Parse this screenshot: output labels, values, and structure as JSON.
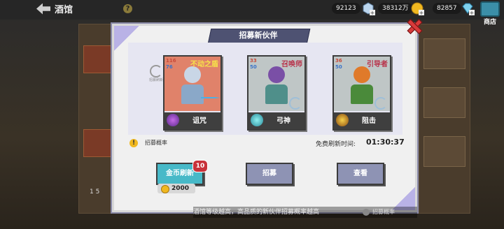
{
  "topbar": {
    "back_label": "酒馆",
    "help_label": "?",
    "resources": [
      {
        "icon": "gem-plus-icon",
        "value": "92123"
      },
      {
        "icon": "gold-coin-icon",
        "value": "38312万"
      },
      {
        "icon": "diamond-icon",
        "value": "82857"
      }
    ],
    "shop_label": "商店"
  },
  "modal": {
    "title": "招募新伙伴",
    "refresh_small_label": "招募刷新",
    "cards": [
      {
        "atk": "116",
        "def": "76",
        "role": "不动之盾",
        "skill": "诅咒",
        "skill_icon": "purple-flame-icon",
        "colors": {
          "bg": "#e0826a",
          "head": "#c9d6e6",
          "body": "#8aa8c8"
        }
      },
      {
        "atk": "33",
        "def": "50",
        "role": "召唤师",
        "skill": "弓神",
        "skill_icon": "cyan-crystal-icon",
        "colors": {
          "bg": "#bfc6c6",
          "head": "#7a4fa6",
          "body": "#4f8f8a"
        }
      },
      {
        "atk": "36",
        "def": "50",
        "role": "引导者",
        "skill": "阻击",
        "skill_icon": "fire-blast-icon",
        "colors": {
          "bg": "#bfc6c6",
          "head": "#e07a2a",
          "body": "#4a8a3a"
        }
      }
    ],
    "info_label": "招募概率",
    "free_refresh_label": "免费刷新时间:",
    "free_refresh_time": "01:30:37",
    "buttons": {
      "gold_refresh": "金币刷新",
      "gold_refresh_badge": "10",
      "gold_refresh_cost": "2000",
      "recruit": "招募",
      "view": "查看"
    }
  },
  "bottom_note": "酒馆等级越高，高品质的新伙伴招募概率越高",
  "bottom_right_label": "招募概率",
  "bottom_left_nums": "1  5",
  "colors": {
    "accent": "#47b9c8",
    "banner": "#4e5272",
    "badge": "#c8323a"
  }
}
